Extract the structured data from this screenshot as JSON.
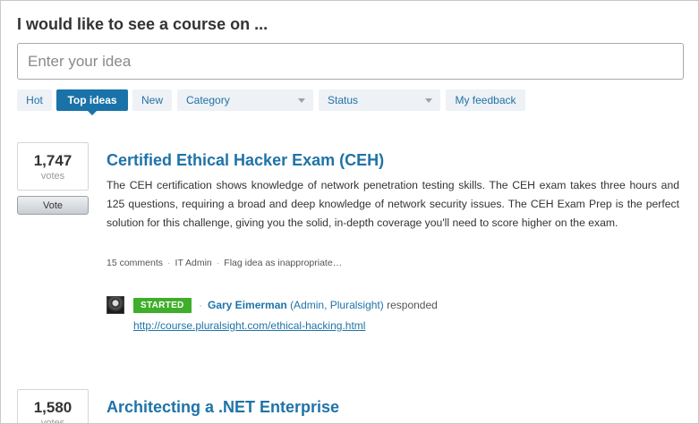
{
  "heading": "I would like to see a course on ...",
  "search": {
    "placeholder": "Enter your idea"
  },
  "filters": {
    "hot": "Hot",
    "top_ideas": "Top ideas",
    "new": "New",
    "category": "Category",
    "status": "Status",
    "my_feedback": "My feedback",
    "active": "Top ideas"
  },
  "ideas": [
    {
      "votes": "1,747",
      "votes_label": "votes",
      "vote_button": "Vote",
      "title": "Certified Ethical Hacker Exam (CEH)",
      "body": "The CEH certification shows knowledge of network penetration testing skills. The CEH exam takes three hours and 125 questions, requiring a broad and deep knowledge of network security issues. The CEH Exam Prep is the perfect solution for this challenge, giving you the solid, in-depth coverage you'll need to score higher on the exam.",
      "comments": "15 comments",
      "author": "IT Admin",
      "flag": "Flag idea as inappropriate…",
      "response": {
        "status": "STARTED",
        "status_color": "#3fae2a",
        "responder": "Gary Eimerman",
        "role": "(Admin, Pluralsight)",
        "verb": "responded",
        "link": "http://course.pluralsight.com/ethical-hacking.html"
      }
    },
    {
      "votes": "1,580",
      "votes_label": "votes",
      "title": "Architecting a .NET Enterprise"
    }
  ],
  "colors": {
    "accent": "#1f73a8",
    "active_tab": "#1a73a8",
    "filter_bg": "#eef1f5",
    "status_started": "#3fae2a"
  },
  "icons": {
    "caret": "chevron-down-icon",
    "avatar": "admin-avatar"
  }
}
